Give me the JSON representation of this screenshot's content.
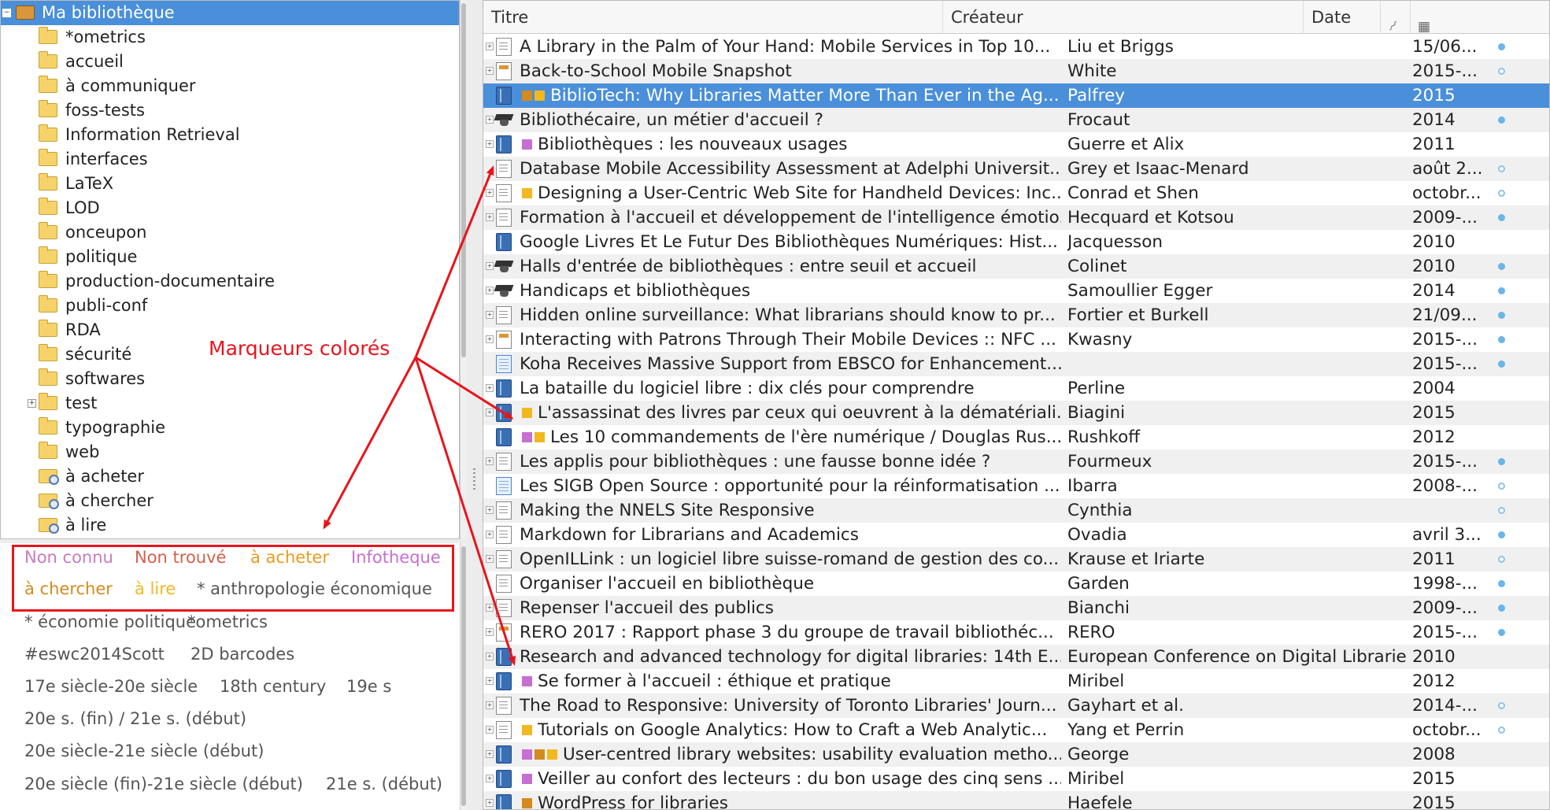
{
  "tree": {
    "root_label": "Ma bibliothèque",
    "collections": [
      {
        "label": "*ometrics",
        "type": "folder"
      },
      {
        "label": "accueil",
        "type": "folder"
      },
      {
        "label": "à communiquer",
        "type": "folder"
      },
      {
        "label": "foss-tests",
        "type": "folder"
      },
      {
        "label": "Information Retrieval",
        "type": "folder"
      },
      {
        "label": "interfaces",
        "type": "folder"
      },
      {
        "label": "LaTeX",
        "type": "folder"
      },
      {
        "label": "LOD",
        "type": "folder"
      },
      {
        "label": "onceupon",
        "type": "folder"
      },
      {
        "label": "politique",
        "type": "folder"
      },
      {
        "label": "production-documentaire",
        "type": "folder"
      },
      {
        "label": "publi-conf",
        "type": "folder"
      },
      {
        "label": "RDA",
        "type": "folder"
      },
      {
        "label": "sécurité",
        "type": "folder"
      },
      {
        "label": "softwares",
        "type": "folder"
      },
      {
        "label": "test",
        "type": "folder",
        "expandable": true
      },
      {
        "label": "typographie",
        "type": "folder"
      },
      {
        "label": "web",
        "type": "folder"
      },
      {
        "label": "à acheter",
        "type": "saved-search"
      },
      {
        "label": "à chercher",
        "type": "saved-search"
      },
      {
        "label": "à lire",
        "type": "saved-search"
      }
    ]
  },
  "tags": {
    "colored": [
      {
        "label": "Non connu",
        "color": "#c77bc1"
      },
      {
        "label": "Non trouvé",
        "color": "#d3604a"
      },
      {
        "label": "à acheter",
        "color": "#e89b1f"
      },
      {
        "label": "Infotheque",
        "color": "#c66fd1"
      },
      {
        "label": "à chercher",
        "color": "#d48a1c"
      },
      {
        "label": "à lire",
        "color": "#f1b820"
      },
      {
        "label": "* anthropologie économique",
        "color": "#555555"
      }
    ],
    "plain": [
      "* économie politique",
      "*ometrics",
      "#eswc2014Scott",
      "2D barcodes",
      "17e siècle-20e siècle",
      "18th century",
      "19e s",
      "20e s. (fin) / 21e s. (début)",
      "20e siècle-21e siècle (début)",
      "20e siècle (fin)-21e siècle (début)",
      "21e s. (début)"
    ]
  },
  "annotation": {
    "label": "Marqueurs colorés",
    "color": "#e8141c"
  },
  "columns": {
    "title": "Titre",
    "creator": "Créateur",
    "date": "Date",
    "attachments_icon": "paperclip-icon",
    "extra_icon": "column-picker-icon"
  },
  "marker_colors": {
    "orange": "#f1b820",
    "brown": "#d48a1c",
    "purple": "#c66fd1"
  },
  "items": [
    {
      "title": "A Library in the Palm of Your Hand: Mobile Services in Top 10...",
      "creator": "Liu et Briggs",
      "date": "15/06...",
      "type": "doc",
      "attachment": "full",
      "expandable": true,
      "markers": []
    },
    {
      "title": "Back-to-School Mobile Snapshot",
      "creator": "White",
      "date": "2015-...",
      "type": "report",
      "attachment": "empty",
      "expandable": true,
      "markers": []
    },
    {
      "title": "BiblioTech: Why Libraries Matter More Than Ever in the Ag...",
      "creator": "Palfrey",
      "date": "2015",
      "type": "book",
      "attachment": "none",
      "expandable": false,
      "markers": [
        "brown",
        "orange"
      ],
      "selected": true
    },
    {
      "title": "Bibliothécaire, un métier d'accueil ?",
      "creator": "Frocaut",
      "date": "2014",
      "type": "thesis",
      "attachment": "full",
      "expandable": true,
      "markers": []
    },
    {
      "title": "Bibliothèques : les nouveaux usages",
      "creator": "Guerre et Alix",
      "date": "2011",
      "type": "book",
      "attachment": "none",
      "expandable": true,
      "markers": [
        "purple"
      ]
    },
    {
      "title": "Database Mobile Accessibility Assessment at Adelphi Universit...",
      "creator": "Grey et Isaac-Menard",
      "date": "août 2...",
      "type": "doc",
      "attachment": "empty",
      "expandable": false,
      "markers": []
    },
    {
      "title": "Designing a User-Centric Web Site for Handheld Devices: Inc...",
      "creator": "Conrad et Shen",
      "date": "octobr...",
      "type": "doc",
      "attachment": "empty",
      "expandable": true,
      "markers": [
        "orange"
      ]
    },
    {
      "title": "Formation à l'accueil et développement de l'intelligence émotio...",
      "creator": "Hecquard et Kotsou",
      "date": "2009-...",
      "type": "doc",
      "attachment": "full",
      "expandable": true,
      "markers": []
    },
    {
      "title": "Google Livres Et Le Futur Des Bibliothèques Numériques: Hist...",
      "creator": "Jacquesson",
      "date": "2010",
      "type": "book",
      "attachment": "none",
      "expandable": false,
      "markers": []
    },
    {
      "title": "Halls d'entrée de bibliothèques : entre seuil et accueil",
      "creator": "Colinet",
      "date": "2010",
      "type": "thesis",
      "attachment": "full",
      "expandable": true,
      "markers": []
    },
    {
      "title": "Handicaps et bibliothèques",
      "creator": "Samoullier Egger",
      "date": "2014",
      "type": "thesis",
      "attachment": "full",
      "expandable": true,
      "markers": []
    },
    {
      "title": "Hidden online surveillance: What librarians should know to pr...",
      "creator": "Fortier et Burkell",
      "date": "21/09...",
      "type": "doc",
      "attachment": "full",
      "expandable": true,
      "markers": []
    },
    {
      "title": "Interacting with Patrons Through Their Mobile Devices :: NFC ...",
      "creator": "Kwasny",
      "date": "2015-...",
      "type": "report",
      "attachment": "full",
      "expandable": true,
      "markers": []
    },
    {
      "title": "Koha Receives Massive Support from EBSCO for Enhancement...",
      "creator": "",
      "date": "2015-...",
      "type": "web",
      "attachment": "full",
      "expandable": false,
      "markers": []
    },
    {
      "title": "La bataille du logiciel libre : dix clés pour comprendre",
      "creator": "Perline",
      "date": "2004",
      "type": "book",
      "attachment": "none",
      "expandable": true,
      "markers": []
    },
    {
      "title": "L'assassinat des livres par ceux qui oeuvrent à la dématériali...",
      "creator": "Biagini",
      "date": "2015",
      "type": "book",
      "attachment": "none",
      "expandable": true,
      "markers": [
        "orange"
      ]
    },
    {
      "title": "Les 10 commandements de l'ère numérique / Douglas Rus...",
      "creator": "Rushkoff",
      "date": "2012",
      "type": "book",
      "attachment": "none",
      "expandable": false,
      "markers": [
        "purple",
        "orange"
      ]
    },
    {
      "title": "Les applis pour bibliothèques : une fausse bonne idée ?",
      "creator": "Fourmeux",
      "date": "2015-...",
      "type": "doc",
      "attachment": "full",
      "expandable": true,
      "markers": []
    },
    {
      "title": "Les SIGB Open Source : opportunité pour la réinformatisation ...",
      "creator": "Ibarra",
      "date": "2008-...",
      "type": "web",
      "attachment": "empty",
      "expandable": false,
      "markers": []
    },
    {
      "title": "Making the NNELS Site Responsive",
      "creator": "Cynthia",
      "date": "",
      "type": "doc",
      "attachment": "empty",
      "expandable": true,
      "markers": []
    },
    {
      "title": "Markdown for Librarians and Academics",
      "creator": "Ovadia",
      "date": "avril 3...",
      "type": "doc",
      "attachment": "full",
      "expandable": true,
      "markers": []
    },
    {
      "title": "OpenILLink : un logiciel libre suisse-romand de gestion des co...",
      "creator": "Krause et Iriarte",
      "date": "2011",
      "type": "doc",
      "attachment": "empty",
      "expandable": true,
      "markers": []
    },
    {
      "title": "Organiser l'accueil en bibliothèque",
      "creator": "Garden",
      "date": "1998-...",
      "type": "doc",
      "attachment": "full",
      "expandable": false,
      "markers": []
    },
    {
      "title": "Repenser l'accueil des publics",
      "creator": "Bianchi",
      "date": "2009-...",
      "type": "doc",
      "attachment": "full",
      "expandable": true,
      "markers": []
    },
    {
      "title": "RERO 2017 : Rapport phase 3 du groupe de travail bibliothéc...",
      "creator": "RERO",
      "date": "2015-...",
      "type": "report",
      "attachment": "full",
      "expandable": true,
      "markers": []
    },
    {
      "title": "Research and advanced technology for digital libraries: 14th E...",
      "creator": "European Conference on Digital Libraries",
      "date": "2010",
      "type": "book",
      "attachment": "none",
      "expandable": true,
      "markers": []
    },
    {
      "title": "Se former à l'accueil : éthique et pratique",
      "creator": "Miribel",
      "date": "2012",
      "type": "book",
      "attachment": "none",
      "expandable": true,
      "markers": [
        "purple"
      ]
    },
    {
      "title": "The Road to Responsive: University of Toronto Libraries' Journ...",
      "creator": "Gayhart et al.",
      "date": "2014-...",
      "type": "doc",
      "attachment": "empty",
      "expandable": true,
      "markers": []
    },
    {
      "title": "Tutorials on Google Analytics: How to Craft a Web Analytic...",
      "creator": "Yang et Perrin",
      "date": "octobr...",
      "type": "doc",
      "attachment": "empty",
      "expandable": true,
      "markers": [
        "orange"
      ]
    },
    {
      "title": "User-centred library websites: usability evaluation metho...",
      "creator": "George",
      "date": "2008",
      "type": "book",
      "attachment": "none",
      "expandable": true,
      "markers": [
        "purple",
        "brown",
        "orange"
      ]
    },
    {
      "title": "Veiller au confort des lecteurs : du bon usage des cinq sens ...",
      "creator": "Miribel",
      "date": "2015",
      "type": "book",
      "attachment": "none",
      "expandable": true,
      "markers": [
        "purple"
      ]
    },
    {
      "title": "WordPress for libraries",
      "creator": "Haefele",
      "date": "2015",
      "type": "book",
      "attachment": "none",
      "expandable": true,
      "markers": [
        "brown"
      ]
    }
  ]
}
